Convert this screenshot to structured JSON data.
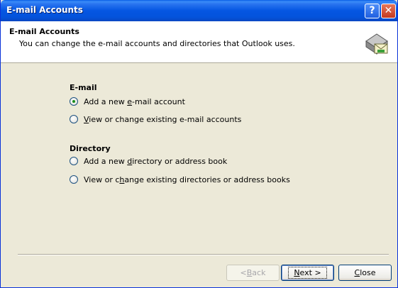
{
  "window": {
    "title": "E-mail Accounts",
    "help_glyph": "?",
    "close_glyph": "✕"
  },
  "header": {
    "title": "E-mail Accounts",
    "subtitle": "You can change the e-mail accounts and directories that Outlook uses."
  },
  "email_section": {
    "label": "E-mail",
    "options": [
      {
        "pre": "Add a new ",
        "key": "e",
        "post": "-mail account",
        "checked": true
      },
      {
        "pre": "",
        "key": "V",
        "post": "iew or change existing e-mail accounts",
        "checked": false
      }
    ]
  },
  "directory_section": {
    "label": "Directory",
    "options": [
      {
        "pre": "Add a new ",
        "key": "d",
        "post": "irectory or address book",
        "checked": false
      },
      {
        "pre": "View or c",
        "key": "h",
        "post": "ange existing directories or address books",
        "checked": false
      }
    ]
  },
  "buttons": {
    "back_pre": "< ",
    "back_key": "B",
    "back_post": "ack",
    "next_key": "N",
    "next_post": "ext >",
    "close_key": "C",
    "close_post": "lose"
  },
  "colors": {
    "titlebar": "#0556e2",
    "dialog_bg": "#ece9d8",
    "radio_dot": "#1a8c1a"
  }
}
